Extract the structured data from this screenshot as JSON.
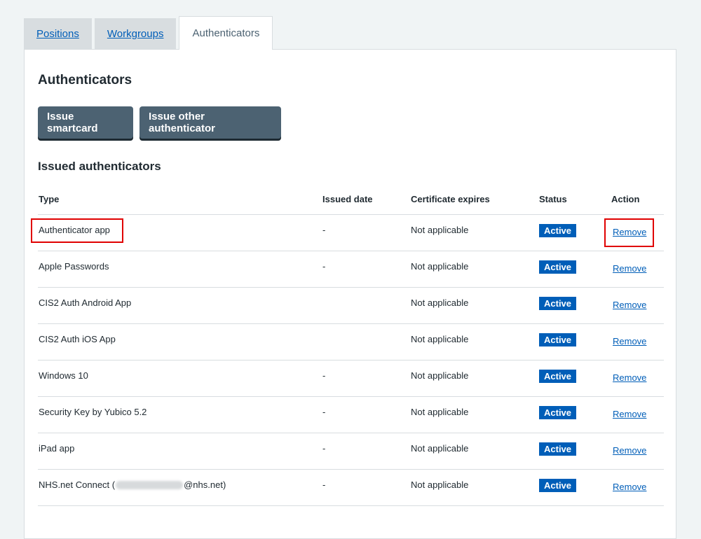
{
  "tabs": [
    {
      "label": "Positions",
      "active": false
    },
    {
      "label": "Workgroups",
      "active": false
    },
    {
      "label": "Authenticators",
      "active": true
    }
  ],
  "panel": {
    "title": "Authenticators",
    "buttons": {
      "issue_smartcard": "Issue smartcard",
      "issue_other": "Issue other authenticator"
    },
    "section_title": "Issued authenticators"
  },
  "table": {
    "headers": [
      "Type",
      "Issued date",
      "Certificate expires",
      "Status",
      "Action"
    ],
    "rows": [
      {
        "type": "Authenticator app",
        "issued": "-",
        "expires": "Not applicable",
        "status": "Active",
        "action": "Remove"
      },
      {
        "type": "Apple Passwords",
        "issued": "-",
        "expires": "Not applicable",
        "status": "Active",
        "action": "Remove"
      },
      {
        "type": "CIS2 Auth Android App",
        "issued": "",
        "expires": "Not applicable",
        "status": "Active",
        "action": "Remove"
      },
      {
        "type": "CIS2 Auth iOS App",
        "issued": "",
        "expires": "Not applicable",
        "status": "Active",
        "action": "Remove"
      },
      {
        "type": "Windows 10",
        "issued": "-",
        "expires": "Not applicable",
        "status": "Active",
        "action": "Remove"
      },
      {
        "type": "Security Key by Yubico 5.2",
        "issued": "-",
        "expires": "Not applicable",
        "status": "Active",
        "action": "Remove"
      },
      {
        "type": "iPad app",
        "issued": "-",
        "expires": "Not applicable",
        "status": "Active",
        "action": "Remove"
      },
      {
        "type_prefix": "NHS.net Connect (",
        "type_suffix": "@nhs.net)",
        "issued": "-",
        "expires": "Not applicable",
        "status": "Active",
        "action": "Remove"
      }
    ]
  },
  "colors": {
    "accent": "#005eb8",
    "button": "#4c6272",
    "highlight": "#e00000"
  }
}
